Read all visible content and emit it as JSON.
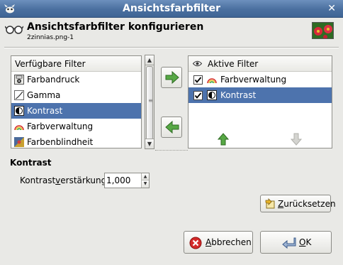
{
  "window": {
    "title": "Ansichtsfarbfilter"
  },
  "header": {
    "title": "Ansichtsfarbfilter konfigurieren",
    "subtitle": "2zinnias.png-1"
  },
  "available": {
    "header": "Verfügbare Filter",
    "items": [
      {
        "label": "Farbandruck",
        "icon": "printer-icon",
        "selected": false
      },
      {
        "label": "Gamma",
        "icon": "gamma-curve-icon",
        "selected": false
      },
      {
        "label": "Kontrast",
        "icon": "contrast-icon",
        "selected": true
      },
      {
        "label": "Farbverwaltung",
        "icon": "color-management-icon",
        "selected": false
      },
      {
        "label": "Farbenblindheit",
        "icon": "colorblind-icon",
        "selected": false
      }
    ]
  },
  "active": {
    "header": "Aktive Filter",
    "items": [
      {
        "label": "Farbverwaltung",
        "icon": "color-management-icon",
        "checked": true,
        "selected": false
      },
      {
        "label": "Kontrast",
        "icon": "contrast-icon",
        "checked": true,
        "selected": true
      }
    ]
  },
  "settings": {
    "section_title": "Kontrast",
    "label_pre": "Kontrast",
    "label_mnemonic": "v",
    "label_post": "erstärkung:",
    "value": "1,000"
  },
  "buttons": {
    "reset_mnemonic": "Z",
    "reset_rest": "urücksetzen",
    "cancel_mnemonic": "A",
    "cancel_rest": "bbrechen",
    "ok_mnemonic": "O",
    "ok_rest": "K"
  },
  "colors": {
    "selection": "#4d73ad",
    "arrow_green": "#57a845",
    "titlebar": "#4a6f9f"
  }
}
